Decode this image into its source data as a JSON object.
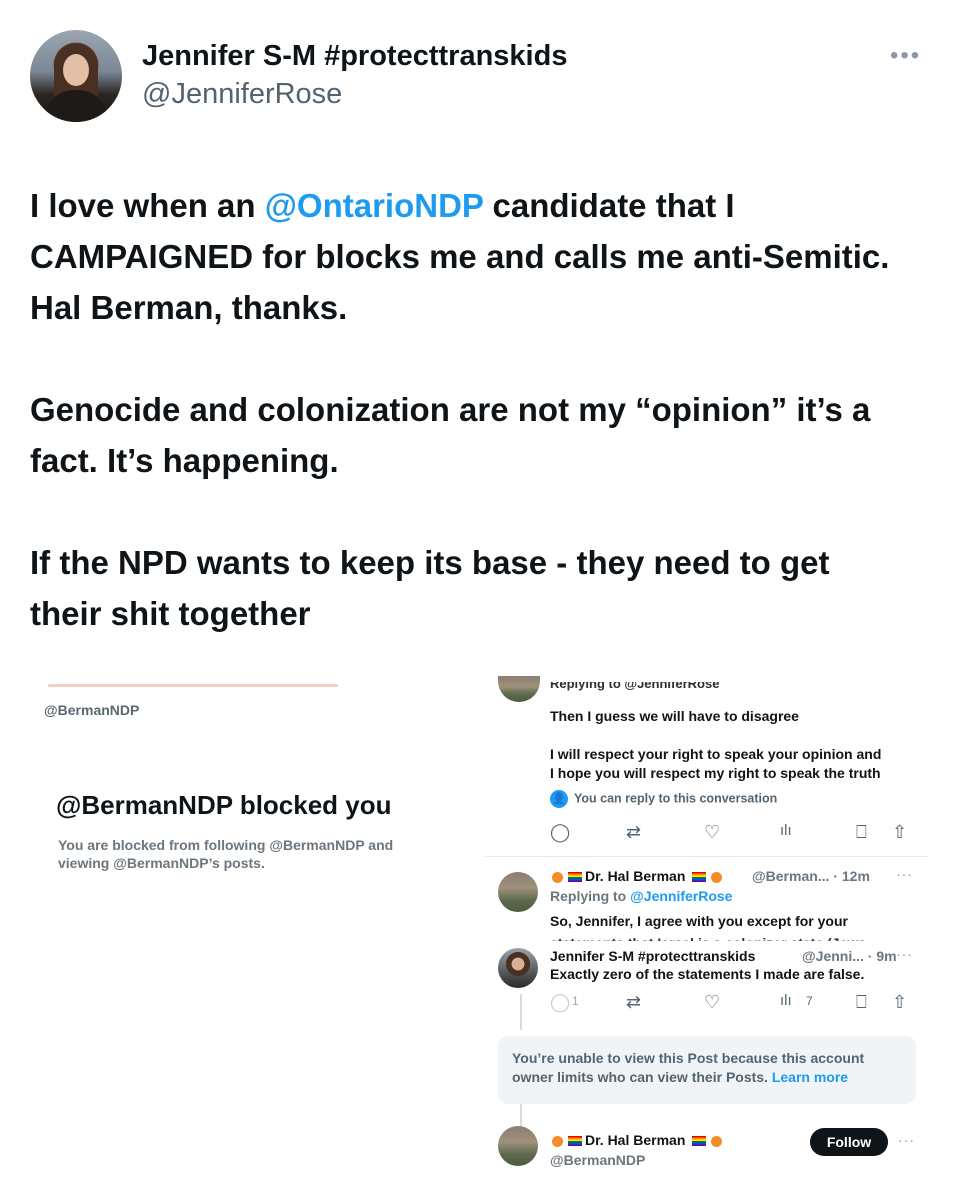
{
  "author": {
    "display_name": "Jennifer S-M #protecttranskids",
    "handle": "@JenniferRose"
  },
  "tweet": {
    "p1_before": "I love when an ",
    "p1_mention": "@OntarioNDP",
    "p1_after": " candidate that I CAMPAIGNED for blocks me and calls me anti-Semitic. Hal Berman, thanks.",
    "p2": "Genocide and colonization are not my “opinion” it’s a fact. It’s happening.",
    "p3": "If the NPD wants to keep its base - they need to get their shit together"
  },
  "more_label": "•••",
  "attachment": {
    "left": {
      "handle": "@BermanNDP",
      "title": "@BermanNDP blocked you",
      "description": "You are blocked from following @BermanNDP and viewing @BermanNDP’s posts."
    },
    "right": {
      "cut_top": "Replying to @JenniferRose",
      "reply1_line1": "Then I guess we will have to disagree",
      "reply1_line2": "I will respect your right to speak your opinion and",
      "reply1_line3": "I hope you will respect my right to speak the truth",
      "can_reply": "You can reply to this conversation",
      "hal_name": "Dr. Hal Berman",
      "hal_handle_time": "@Berman... · 12m",
      "replying_to_label": "Replying to ",
      "replying_to_user": "@JenniferRose",
      "hal_text": "So, Jennifer, I agree with you except for your",
      "hal_text_cut": "statements that Israel is a colonizer state (Jews",
      "jen_name": "Jennifer S-M #protecttranskids",
      "jen_handle_time": "@Jenni... · 9m",
      "jen_text": "Exactly zero of the statements I made are false.",
      "reply_count": "1",
      "views_count": "7",
      "notice_text": "You’re unable to view this Post because this account owner limits who can view their Posts.",
      "learn_more": "Learn more",
      "follow_label": "Follow",
      "bottom_name": "Dr. Hal Berman",
      "bottom_handle": "@BermanNDP"
    }
  },
  "icons": [
    "reply-icon",
    "retweet-icon",
    "like-icon",
    "views-icon",
    "bookmark-icon",
    "share-icon",
    "more-icon",
    "person-icon"
  ]
}
